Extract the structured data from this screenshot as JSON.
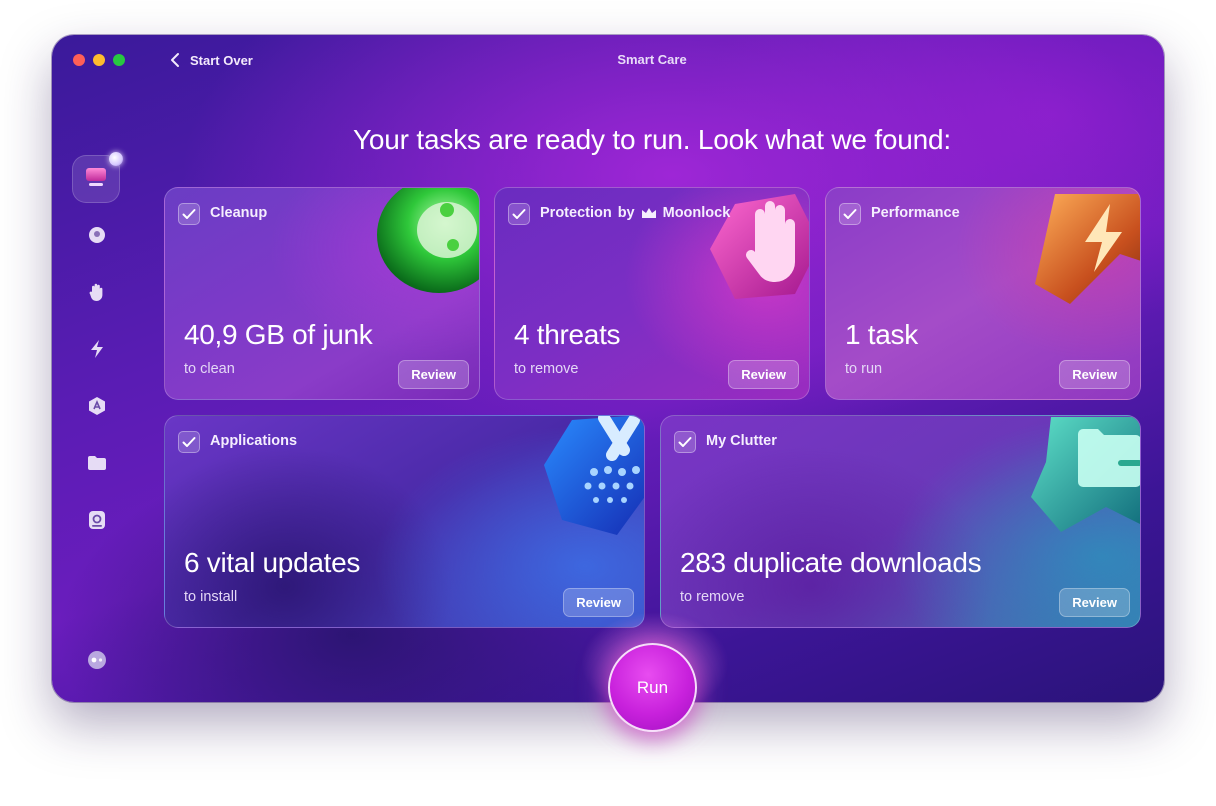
{
  "window": {
    "title": "Smart Care",
    "back_label": "Start Over"
  },
  "headline": "Your tasks are ready to run. Look what we found:",
  "sidebar": {
    "items": [
      {
        "name": "smart-care",
        "icon": "monitor-icon",
        "active": true
      },
      {
        "name": "cleanup",
        "icon": "sphere-icon"
      },
      {
        "name": "protection",
        "icon": "hand-icon"
      },
      {
        "name": "performance",
        "icon": "lightning-icon"
      },
      {
        "name": "applications",
        "icon": "app-icon"
      },
      {
        "name": "my-clutter",
        "icon": "folder-icon"
      },
      {
        "name": "space-lens",
        "icon": "disk-icon"
      }
    ],
    "bottom_icon": "assistant-icon"
  },
  "cards": {
    "cleanup": {
      "title": "Cleanup",
      "value": "40,9 GB of junk",
      "sub": "to clean",
      "review": "Review",
      "checked": true
    },
    "protection": {
      "title": "Protection",
      "by": "by",
      "brand": "Moonlock",
      "value": "4 threats",
      "sub": "to remove",
      "review": "Review",
      "checked": true
    },
    "performance": {
      "title": "Performance",
      "value": "1 task",
      "sub": "to run",
      "review": "Review",
      "checked": true
    },
    "applications": {
      "title": "Applications",
      "value": "6 vital updates",
      "sub": "to install",
      "review": "Review",
      "checked": true
    },
    "clutter": {
      "title": "My Clutter",
      "value": "283 duplicate downloads",
      "sub": "to remove",
      "review": "Review",
      "checked": true
    }
  },
  "run_label": "Run",
  "colors": {
    "accent": "#c821dc",
    "window_bg": "#5a1cb4"
  }
}
